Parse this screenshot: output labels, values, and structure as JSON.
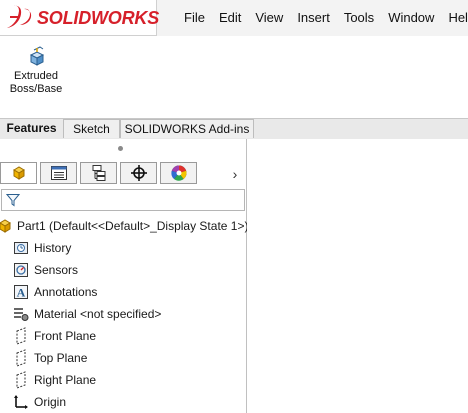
{
  "app": {
    "brand": "SOLIDWORKS",
    "brand_prefix": "3DS"
  },
  "menu": {
    "items": [
      {
        "label": "File"
      },
      {
        "label": "Edit"
      },
      {
        "label": "View"
      },
      {
        "label": "Insert"
      },
      {
        "label": "Tools"
      },
      {
        "label": "Window"
      },
      {
        "label": "Help"
      }
    ]
  },
  "ribbon": {
    "extrude_button": {
      "label_line1": "Extruded",
      "label_line2": "Boss/Base",
      "icon": "extruded-boss-icon"
    }
  },
  "tabs": [
    {
      "label": "Features",
      "active": true
    },
    {
      "label": "Sketch",
      "active": false
    },
    {
      "label": "SOLIDWORKS Add-ins",
      "active": false
    }
  ],
  "panel_tabs": [
    {
      "icon": "featuremanager-icon",
      "active": true
    },
    {
      "icon": "propertymanager-icon",
      "active": false
    },
    {
      "icon": "configurationmanager-icon",
      "active": false
    },
    {
      "icon": "dimxpert-icon",
      "active": false
    },
    {
      "icon": "display-manager-icon",
      "active": false
    }
  ],
  "tree": {
    "root": {
      "label": "Part1  (Default<<Default>_Display State 1>)",
      "icon": "part-icon"
    },
    "items": [
      {
        "label": "History",
        "icon": "history-icon"
      },
      {
        "label": "Sensors",
        "icon": "sensors-icon"
      },
      {
        "label": "Annotations",
        "icon": "annotations-icon"
      },
      {
        "label": "Material <not specified>",
        "icon": "material-icon"
      },
      {
        "label": "Front Plane",
        "icon": "plane-icon"
      },
      {
        "label": "Top Plane",
        "icon": "plane-icon"
      },
      {
        "label": "Right Plane",
        "icon": "plane-icon"
      },
      {
        "label": "Origin",
        "icon": "origin-icon"
      }
    ]
  },
  "colors": {
    "brand_red": "#d6202a",
    "part_yellow": "#f0b400"
  }
}
